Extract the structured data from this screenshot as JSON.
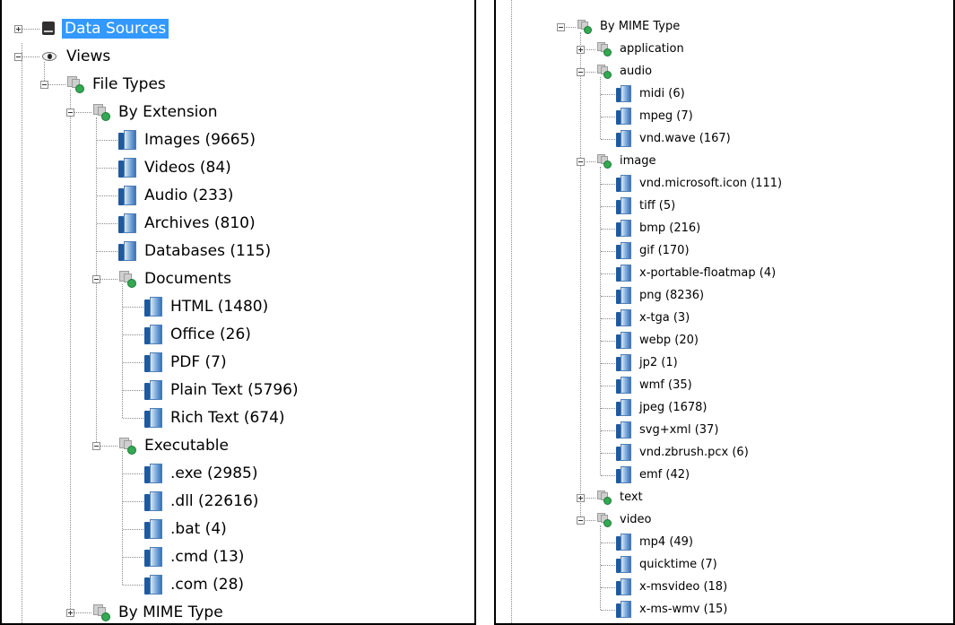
{
  "left_tree": [
    {
      "label": "Data Sources",
      "depth": 0,
      "icon": "database-icon",
      "expander": "plus",
      "selected": true
    },
    {
      "label": "Views",
      "depth": 0,
      "icon": "eye-icon",
      "expander": "minus"
    },
    {
      "label": "File Types",
      "depth": 1,
      "icon": "folder-group-icon",
      "expander": "minus"
    },
    {
      "label": "By Extension",
      "depth": 2,
      "icon": "folder-group-icon",
      "expander": "minus"
    },
    {
      "label": "Images (9665)",
      "depth": 3,
      "icon": "file-icon"
    },
    {
      "label": "Videos (84)",
      "depth": 3,
      "icon": "file-icon"
    },
    {
      "label": "Audio (233)",
      "depth": 3,
      "icon": "file-icon"
    },
    {
      "label": "Archives (810)",
      "depth": 3,
      "icon": "file-icon"
    },
    {
      "label": "Databases (115)",
      "depth": 3,
      "icon": "file-icon"
    },
    {
      "label": "Documents",
      "depth": 3,
      "icon": "folder-group-icon",
      "expander": "minus"
    },
    {
      "label": "HTML (1480)",
      "depth": 4,
      "icon": "file-icon"
    },
    {
      "label": "Office (26)",
      "depth": 4,
      "icon": "file-icon"
    },
    {
      "label": "PDF (7)",
      "depth": 4,
      "icon": "file-icon"
    },
    {
      "label": "Plain Text (5796)",
      "depth": 4,
      "icon": "file-icon"
    },
    {
      "label": "Rich Text (674)",
      "depth": 4,
      "icon": "file-icon"
    },
    {
      "label": "Executable",
      "depth": 3,
      "icon": "folder-group-icon",
      "expander": "minus"
    },
    {
      "label": ".exe (2985)",
      "depth": 4,
      "icon": "file-icon"
    },
    {
      "label": ".dll (22616)",
      "depth": 4,
      "icon": "file-icon"
    },
    {
      "label": ".bat (4)",
      "depth": 4,
      "icon": "file-icon"
    },
    {
      "label": ".cmd (13)",
      "depth": 4,
      "icon": "file-icon"
    },
    {
      "label": ".com (28)",
      "depth": 4,
      "icon": "file-icon"
    },
    {
      "label": "By MIME Type",
      "depth": 2,
      "icon": "folder-group-icon",
      "expander": "plus"
    }
  ],
  "right_tree": [
    {
      "label": "By MIME Type",
      "depth": 0,
      "icon": "folder-group-icon",
      "expander": "minus"
    },
    {
      "label": "application",
      "depth": 1,
      "icon": "folder-group-icon",
      "expander": "plus"
    },
    {
      "label": "audio",
      "depth": 1,
      "icon": "folder-group-icon",
      "expander": "minus"
    },
    {
      "label": "midi (6)",
      "depth": 2,
      "icon": "file-icon"
    },
    {
      "label": "mpeg (7)",
      "depth": 2,
      "icon": "file-icon"
    },
    {
      "label": "vnd.wave (167)",
      "depth": 2,
      "icon": "file-icon"
    },
    {
      "label": "image",
      "depth": 1,
      "icon": "folder-group-icon",
      "expander": "minus"
    },
    {
      "label": "vnd.microsoft.icon (111)",
      "depth": 2,
      "icon": "file-icon"
    },
    {
      "label": "tiff (5)",
      "depth": 2,
      "icon": "file-icon"
    },
    {
      "label": "bmp (216)",
      "depth": 2,
      "icon": "file-icon"
    },
    {
      "label": "gif (170)",
      "depth": 2,
      "icon": "file-icon"
    },
    {
      "label": "x-portable-floatmap (4)",
      "depth": 2,
      "icon": "file-icon"
    },
    {
      "label": "png (8236)",
      "depth": 2,
      "icon": "file-icon"
    },
    {
      "label": "x-tga (3)",
      "depth": 2,
      "icon": "file-icon"
    },
    {
      "label": "webp (20)",
      "depth": 2,
      "icon": "file-icon"
    },
    {
      "label": "jp2 (1)",
      "depth": 2,
      "icon": "file-icon"
    },
    {
      "label": "wmf (35)",
      "depth": 2,
      "icon": "file-icon"
    },
    {
      "label": "jpeg (1678)",
      "depth": 2,
      "icon": "file-icon"
    },
    {
      "label": "svg+xml (37)",
      "depth": 2,
      "icon": "file-icon"
    },
    {
      "label": "vnd.zbrush.pcx (6)",
      "depth": 2,
      "icon": "file-icon"
    },
    {
      "label": "emf (42)",
      "depth": 2,
      "icon": "file-icon"
    },
    {
      "label": "text",
      "depth": 1,
      "icon": "folder-group-icon",
      "expander": "plus"
    },
    {
      "label": "video",
      "depth": 1,
      "icon": "folder-group-icon",
      "expander": "minus"
    },
    {
      "label": "mp4 (49)",
      "depth": 2,
      "icon": "file-icon"
    },
    {
      "label": "quicktime (7)",
      "depth": 2,
      "icon": "file-icon"
    },
    {
      "label": "x-msvideo (18)",
      "depth": 2,
      "icon": "file-icon"
    },
    {
      "label": "x-ms-wmv (15)",
      "depth": 2,
      "icon": "file-icon"
    }
  ],
  "colors": {
    "selection": "#3399ff",
    "file_icon": "#2a6bb5",
    "node_icon_badge": "#34a853"
  }
}
